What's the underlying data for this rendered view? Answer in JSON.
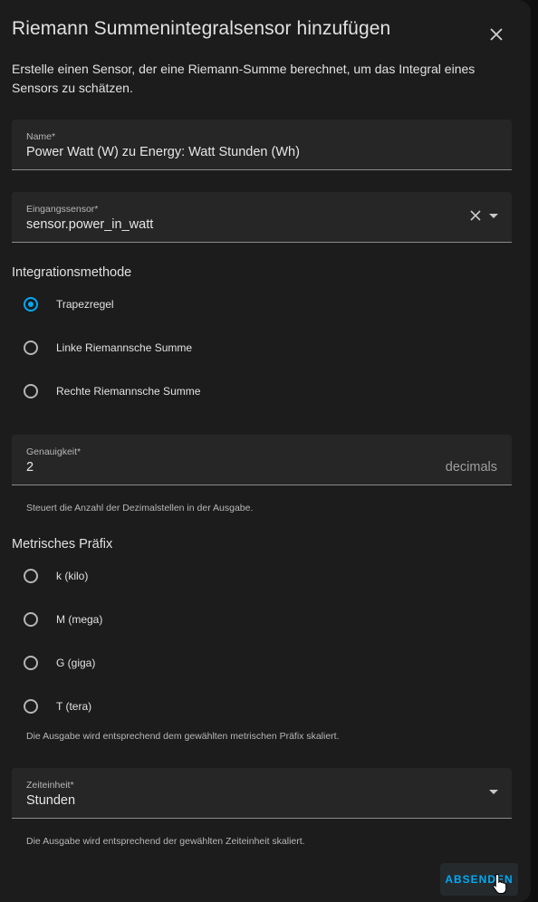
{
  "dialog": {
    "title": "Riemann Summenintegralsensor hinzufügen",
    "description": "Erstelle einen Sensor, der eine Riemann-Summe berechnet, um das Integral eines Sensors zu schätzen."
  },
  "name_field": {
    "label": "Name*",
    "value": "Power Watt (W) zu Energy: Watt Stunden (Wh)"
  },
  "source_field": {
    "label": "Eingangssensor*",
    "value": "sensor.power_in_watt"
  },
  "method": {
    "title": "Integrationsmethode",
    "options": [
      "Trapezregel",
      "Linke Riemannsche Summe",
      "Rechte Riemannsche Summe"
    ],
    "selected": "Trapezregel"
  },
  "precision_field": {
    "label": "Genauigkeit*",
    "value": "2",
    "suffix": "decimals",
    "helper": "Steuert die Anzahl der Dezimalstellen in der Ausgabe."
  },
  "prefix": {
    "title": "Metrisches Präfix",
    "options": [
      "k (kilo)",
      "M (mega)",
      "G (giga)",
      "T (tera)"
    ],
    "helper": "Die Ausgabe wird entsprechend dem gewählten metrischen Präfix skaliert."
  },
  "time_unit_field": {
    "label": "Zeiteinheit*",
    "value": "Stunden",
    "helper": "Die Ausgabe wird entsprechend der gewählten Zeiteinheit skaliert."
  },
  "actions": {
    "submit_label": "ABSENDEN"
  },
  "colors": {
    "accent": "#03a9f4",
    "surface": "#1c1c1c",
    "field": "#262626"
  },
  "icons": [
    "close-icon",
    "clear-icon",
    "dropdown-arrow-icon",
    "pointer-cursor-icon"
  ]
}
